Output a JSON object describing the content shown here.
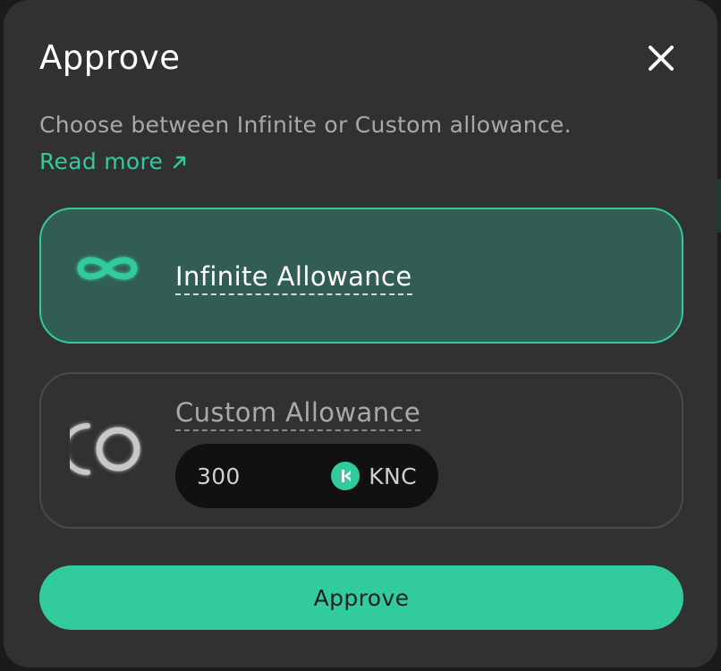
{
  "dialog": {
    "title": "Approve",
    "description": "Choose between Infinite or Custom allowance.",
    "read_more": "Read more",
    "icons": {
      "close": "close-icon",
      "read_more": "arrow-up-right-icon"
    }
  },
  "options": {
    "infinite": {
      "label": "Infinite Allowance",
      "icon": "infinity-icon",
      "selected": true
    },
    "custom": {
      "label": "Custom Allowance",
      "icon": "custom-allowance-icon",
      "selected": false,
      "amount": "300",
      "token": "KNC",
      "token_icon": "knc-token-icon"
    }
  },
  "approve_button": {
    "label": "Approve"
  },
  "colors": {
    "accent": "#31cb9e",
    "modal_bg": "#313131",
    "selected_bg": "#325d52",
    "input_bg": "#111111"
  }
}
